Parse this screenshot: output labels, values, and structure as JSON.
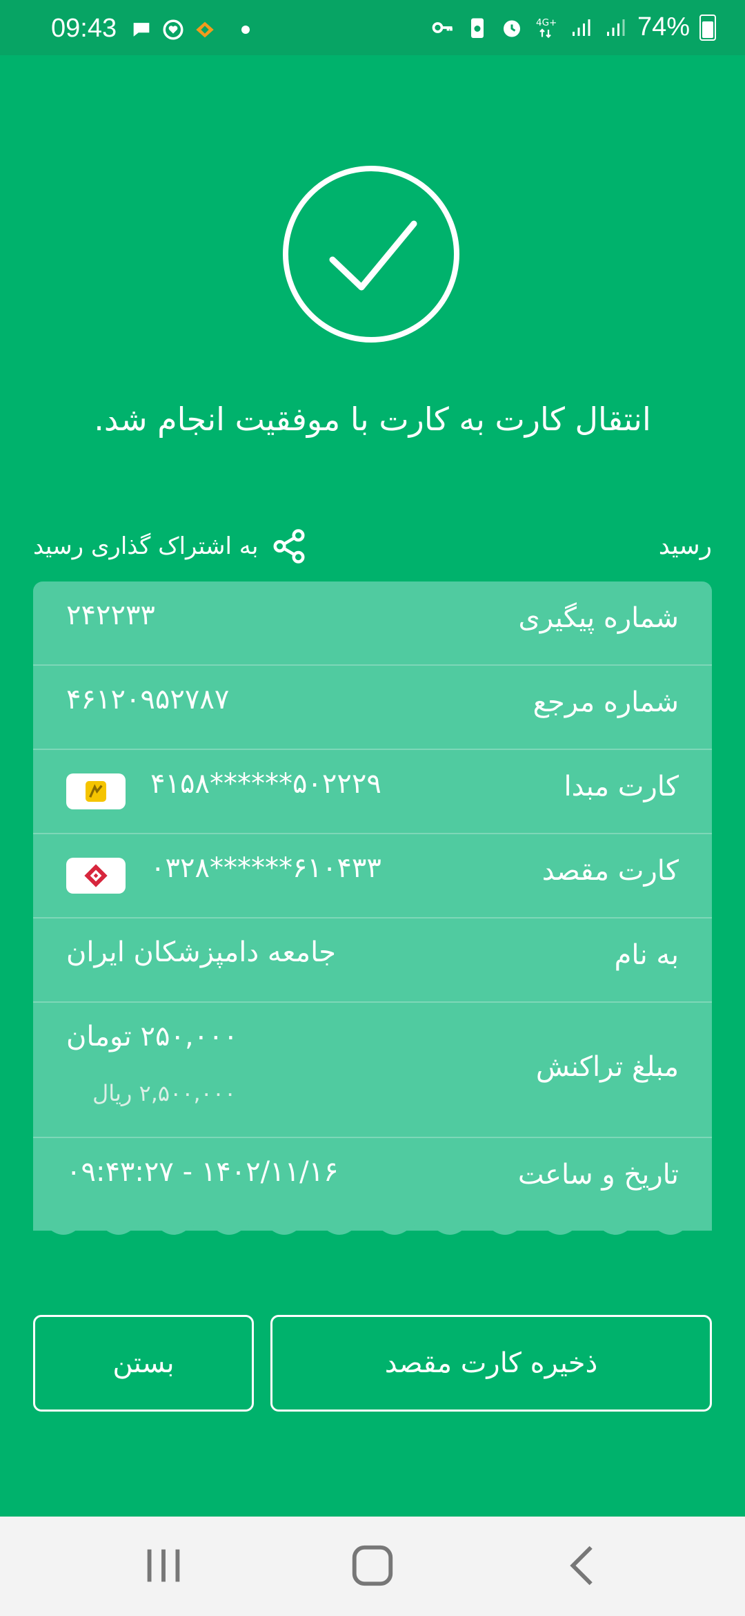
{
  "status_bar": {
    "time": "09:43",
    "battery": "74%",
    "network": "4G+",
    "icons_left": [
      "message-icon",
      "heart-shield-icon",
      "orange-logo-icon"
    ],
    "icons_right": [
      "key-icon",
      "recycle-battery-icon",
      "alarm-icon",
      "4g-icon",
      "signal-icon",
      "signal-icon",
      "battery-icon"
    ]
  },
  "header": {
    "success_icon": "check-circle-icon",
    "message": "انتقال کارت به کارت با موفقیت انجام شد."
  },
  "receipt": {
    "label": "رسید",
    "share_label": "به اشتراک گذاری رسید",
    "rows": [
      {
        "key": "شماره پیگیری",
        "value": "۲۴۲۲۳۳"
      },
      {
        "key": "شماره مرجع",
        "value": "۴۶۱۲۰۹۵۲۷۸۷"
      },
      {
        "key": "کارت مبدا",
        "value": "۵۰۲۲۲۹******۴۱۵۸"
      },
      {
        "key": "کارت مقصد",
        "value": "۶۱۰۴۳۳******۰۳۲۸"
      },
      {
        "key": "به نام",
        "value": "جامعه دامپزشکان ایران"
      },
      {
        "key": "مبلغ تراکنش",
        "value": "۲۵۰,۰۰۰ تومان",
        "sub": "۲,۵۰۰,۰۰۰ ریال"
      },
      {
        "key": "تاریخ و ساعت",
        "value": "۱۴۰۲/۱۱/۱۶ - ۰۹:۴۳:۲۷"
      }
    ]
  },
  "buttons": {
    "save_destination": "ذخیره کارت مقصد",
    "close": "بستن"
  },
  "colors": {
    "background": "#00B26C",
    "card": "#50CBA0",
    "divider": "#7ED7B8"
  }
}
